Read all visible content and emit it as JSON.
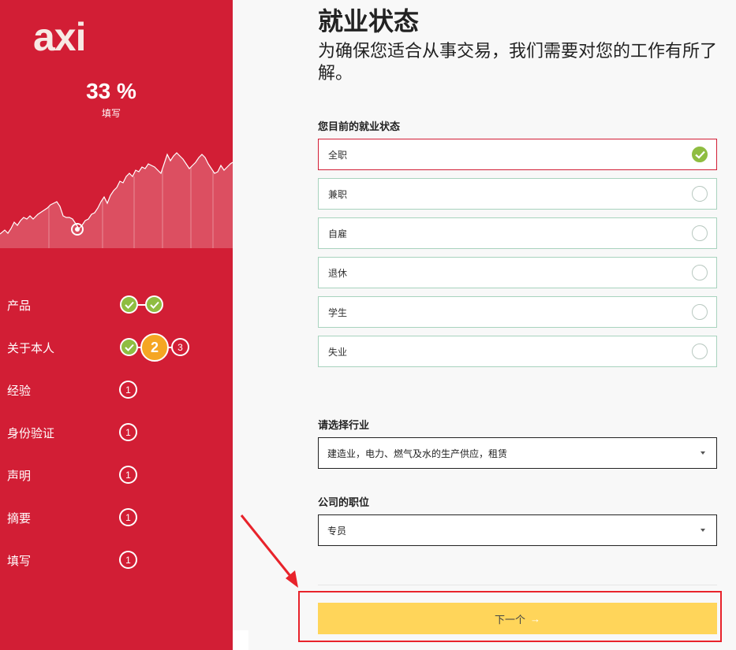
{
  "sidebar": {
    "logo": "axi",
    "progress_percent": "33 %",
    "progress_label": "填写",
    "progress_value": 33,
    "steps": [
      {
        "label": "产品",
        "state": "done",
        "sub_steps": [
          "done",
          "done"
        ]
      },
      {
        "label": "关于本人",
        "state": "active",
        "sub_steps": [
          "done",
          "2",
          "3"
        ]
      },
      {
        "label": "经验",
        "state": "pending",
        "number": "1"
      },
      {
        "label": "身份验证",
        "state": "pending",
        "number": "1"
      },
      {
        "label": "声明",
        "state": "pending",
        "number": "1"
      },
      {
        "label": "摘要",
        "state": "pending",
        "number": "1"
      },
      {
        "label": "填写",
        "state": "pending",
        "number": "1"
      }
    ],
    "colors": {
      "background": "#d21e35",
      "done": "#8fbd41",
      "active": "#f5a623"
    }
  },
  "main": {
    "title": "就业状态",
    "subtitle": "为确保您适合从事交易，我们需要对您的工作有所了解。",
    "employment": {
      "label": "您目前的就业状态",
      "options": [
        {
          "label": "全职",
          "selected": true
        },
        {
          "label": "兼职",
          "selected": false
        },
        {
          "label": "自雇",
          "selected": false
        },
        {
          "label": "退休",
          "selected": false
        },
        {
          "label": "学生",
          "selected": false
        },
        {
          "label": "失业",
          "selected": false
        }
      ]
    },
    "industry": {
      "label": "请选择行业",
      "value": "建造业，电力、燃气及水的生产供应，租赁"
    },
    "position": {
      "label": "公司的职位",
      "value": "专员"
    },
    "next_button": {
      "label": "下一个",
      "icon": "arrow-right-icon"
    },
    "colors": {
      "selected_border": "#d21e35",
      "option_border": "#a8d3be",
      "button": "#ffd55a",
      "annotation": "#e8232b"
    }
  }
}
